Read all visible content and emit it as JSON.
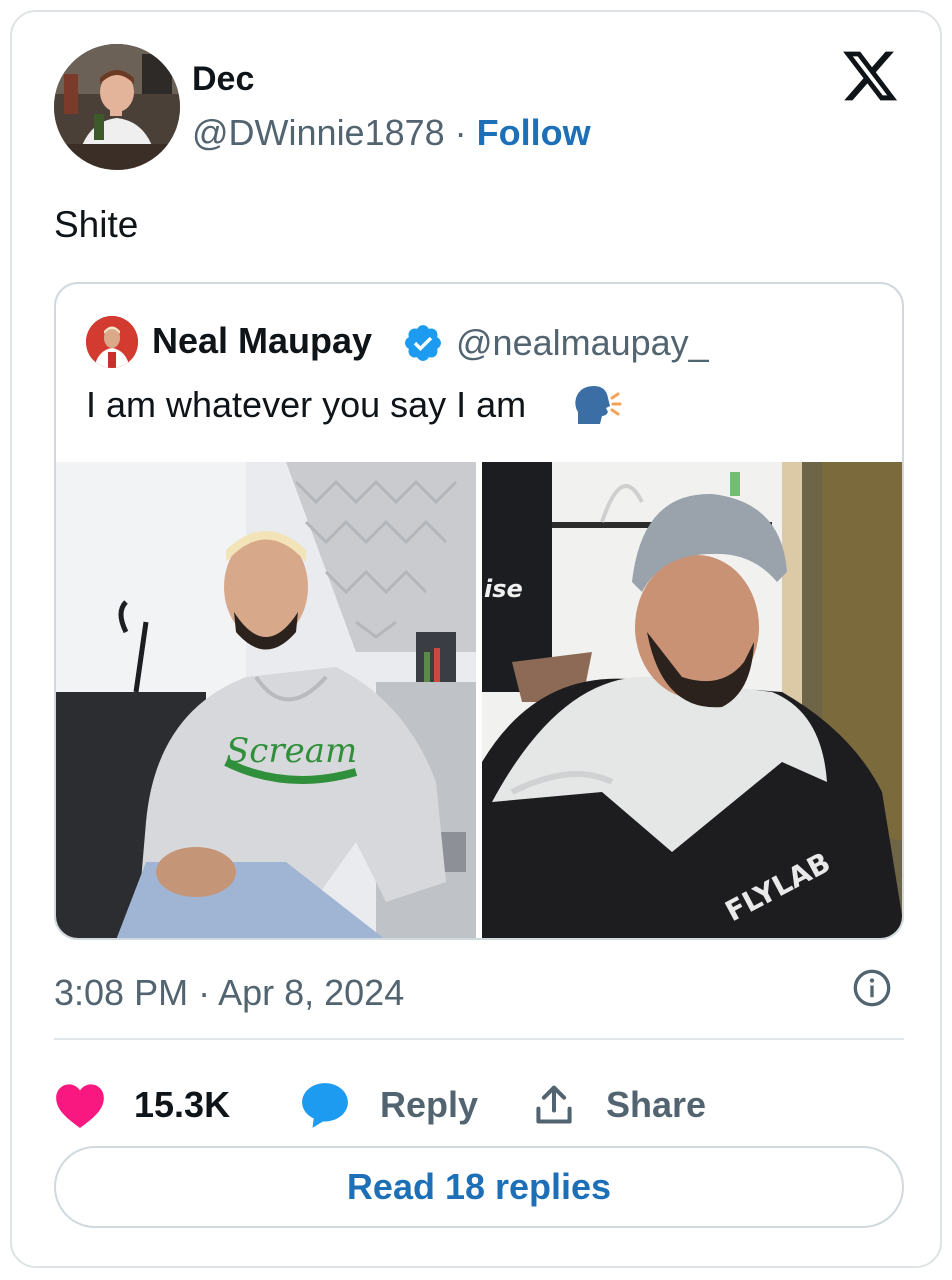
{
  "author": {
    "name": "Dec",
    "handle": "@DWinnie1878",
    "separator": " · ",
    "follow_label": "Follow"
  },
  "tweet": {
    "text": "Shite",
    "timestamp": "3:08 PM · Apr 8, 2024"
  },
  "quoted_tweet": {
    "name": "Neal Maupay",
    "handle": "@nealmaupay_",
    "text": "I am whatever you say I am",
    "emoji": "speaking-head-emoji",
    "verified": true,
    "image_left_hoodie_text": "Scream",
    "image_right_cape_text": "FLYLAB",
    "image_right_shirt_text": "ise"
  },
  "actions": {
    "like_count": "15.3K",
    "reply_label": "Reply",
    "share_label": "Share"
  },
  "read_replies_label": "Read 18 replies",
  "colors": {
    "like": "#f91880",
    "reply": "#1d9bf0",
    "link": "#1d70b8",
    "verified": "#1d9bf0",
    "muted_text": "#536471"
  }
}
